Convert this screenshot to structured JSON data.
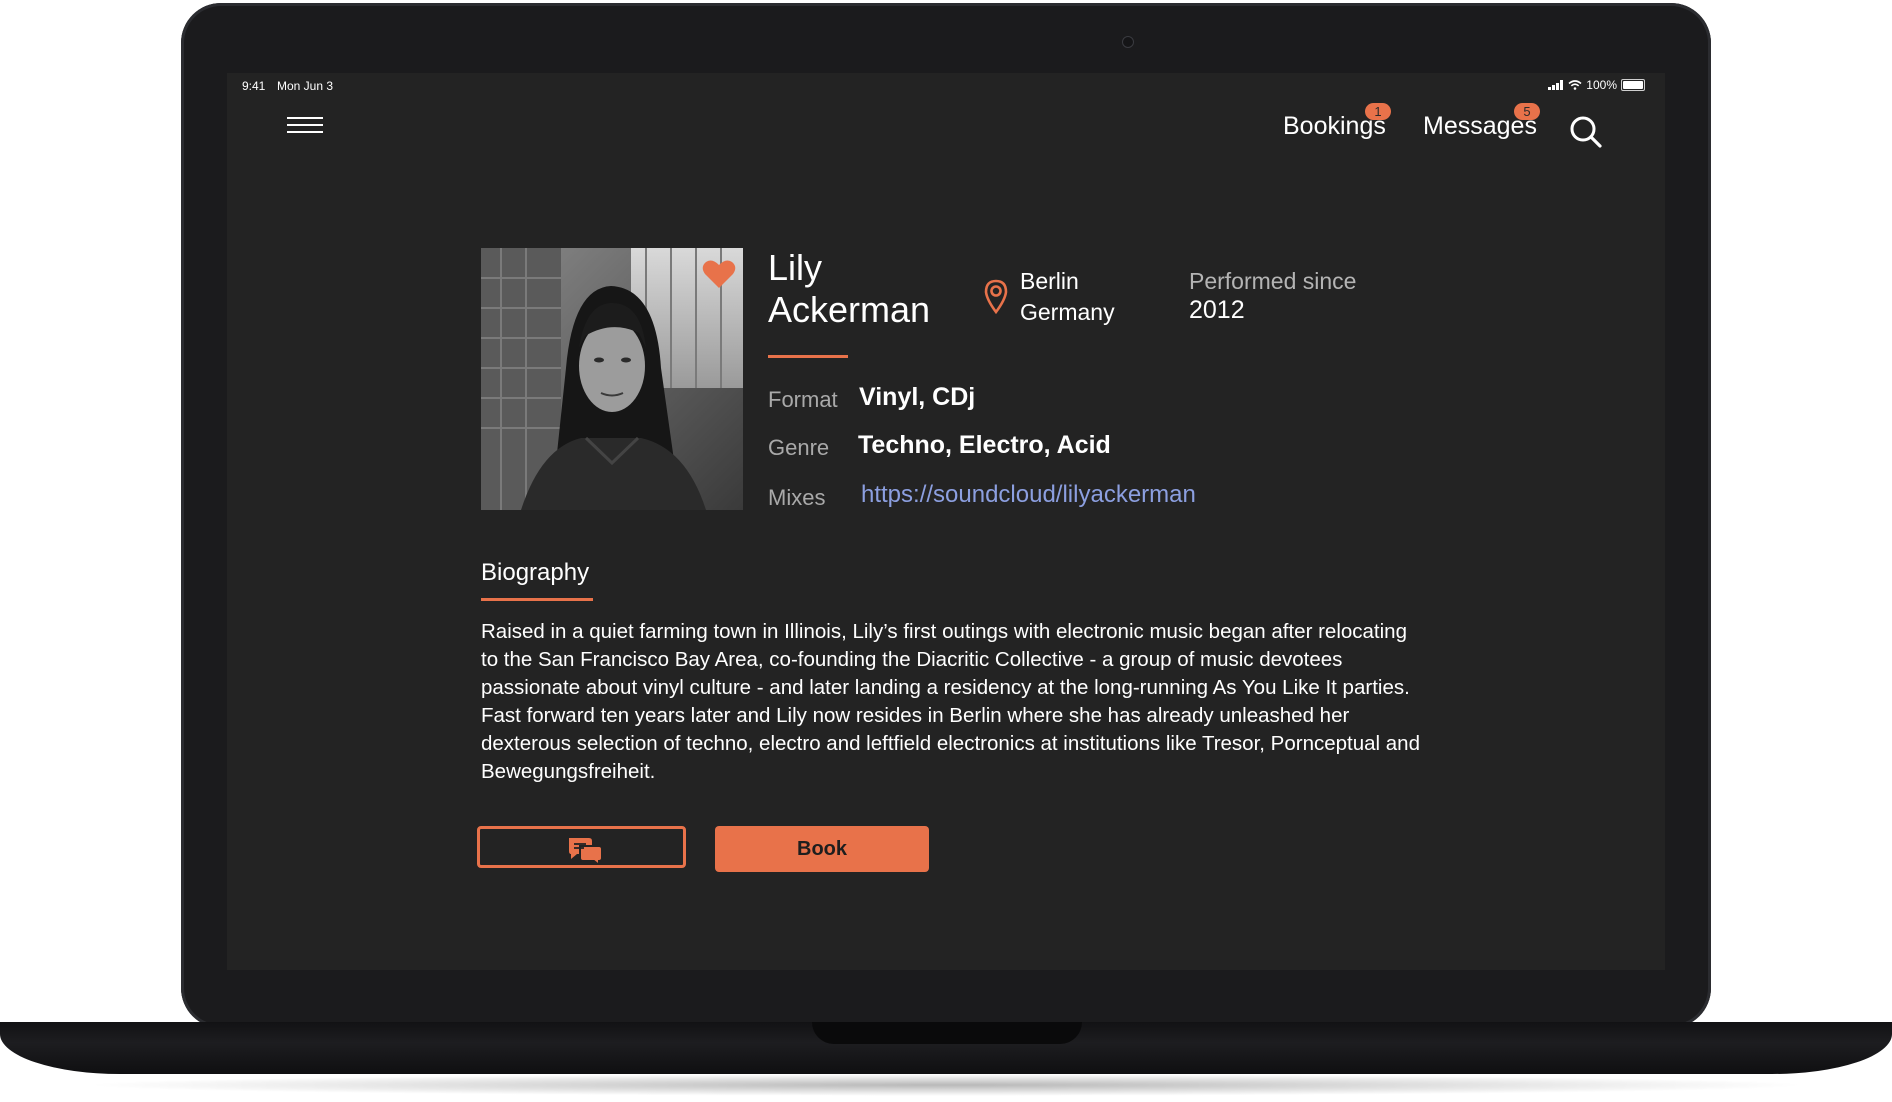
{
  "status_bar": {
    "time": "9:41",
    "date": "Mon Jun 3",
    "battery": "100%"
  },
  "nav": {
    "bookings_label": "Bookings",
    "bookings_count": "1",
    "messages_label": "Messages",
    "messages_count": "5",
    "menu_icon": "hamburger-menu-icon",
    "search_icon": "search-icon"
  },
  "profile": {
    "first_name": "Lily",
    "last_name": "Ackerman",
    "photo_icon": "artist-photo",
    "favorite_icon": "heart-icon",
    "location_icon": "location-pin-icon",
    "city": "Berlin",
    "country": "Germany",
    "performed_since_label": "Performed since",
    "performed_since_value": "2012",
    "format_label": "Format",
    "format_value": "Vinyl, CDj",
    "genre_label": "Genre",
    "genre_value": "Techno, Electro, Acid",
    "mixes_label": "Mixes",
    "mixes_value": "https://soundcloud/lilyackerman"
  },
  "biography": {
    "title": "Biography",
    "text": "Raised in a quiet farming town in Illinois, Lily’s first outings with electronic music began after relocating to the San Francisco Bay Area, co-founding the Diacritic Collective - a group of music devotees passionate about vinyl culture - and later landing a residency at the long-running As You Like It parties. Fast forward ten years later and Lily now resides in Berlin where she has already unleashed her dexterous selection of techno, electro and leftfield electronics at institutions like Tresor, Pornceptual and Bewegungsfreiheit."
  },
  "actions": {
    "message_icon": "chat-bubbles-icon",
    "book_label": "Book"
  },
  "colors": {
    "accent": "#e8724a",
    "background": "#232323",
    "link": "#8c9fe0"
  }
}
